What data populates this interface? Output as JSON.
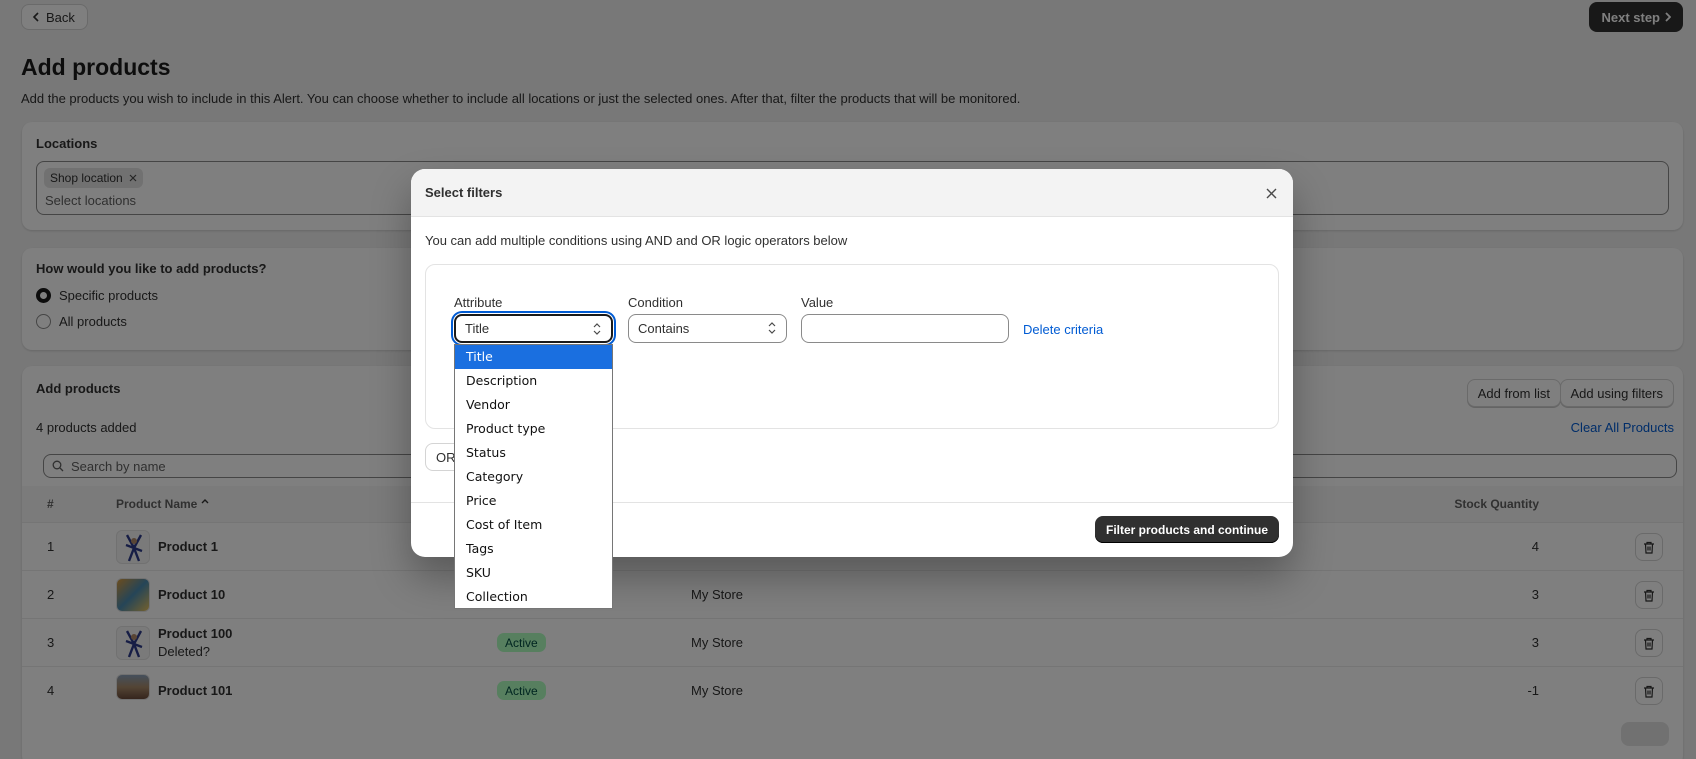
{
  "header": {
    "back_label": "Back",
    "next_label": "Next step",
    "title": "Add products",
    "subtitle": "Add the products you wish to include in this Alert. You can choose whether to include all locations or just the selected ones. After that, filter the products that will be monitored."
  },
  "locations": {
    "title": "Locations",
    "tag": "Shop location",
    "placeholder": "Select locations"
  },
  "how": {
    "title": "How would you like to add products?",
    "options": [
      "Specific products",
      "All products"
    ],
    "selected": "Specific products"
  },
  "products": {
    "title": "Add products",
    "add_from_list": "Add from list",
    "add_using_filters": "Add using filters",
    "count_text": "4 products added",
    "clear_all": "Clear All Products",
    "search_placeholder": "Search by name",
    "columns": {
      "num": "#",
      "name": "Product Name",
      "stock": "Stock Quantity"
    },
    "rows": [
      {
        "num": "1",
        "name": "Product 1",
        "note": "",
        "status": "",
        "store": "",
        "stock": "4"
      },
      {
        "num": "2",
        "name": "Product 10",
        "note": "",
        "status": "",
        "store": "My Store",
        "stock": "3"
      },
      {
        "num": "3",
        "name": "Product 100",
        "note": "Deleted?",
        "status": "Active",
        "store": "My Store",
        "stock": "3"
      },
      {
        "num": "4",
        "name": "Product 101",
        "note": "",
        "status": "Active",
        "store": "My Store",
        "stock": "-1"
      }
    ]
  },
  "modal": {
    "title": "Select filters",
    "intro": "You can add multiple conditions using AND and OR logic operators below",
    "attribute_label": "Attribute",
    "attribute_value": "Title",
    "condition_label": "Condition",
    "condition_value": "Contains",
    "value_label": "Value",
    "value_input": "",
    "delete_criteria": "Delete criteria",
    "or_label": "OR",
    "primary_button": "Filter products and continue"
  },
  "dropdown": {
    "options": [
      "Title",
      "Description",
      "Vendor",
      "Product type",
      "Status",
      "Category",
      "Price",
      "Cost of Item",
      "Tags",
      "SKU",
      "Collection"
    ],
    "selected": "Title"
  },
  "colors": {
    "accent": "#005bd3",
    "primary_dark": "#303030",
    "badge_bg": "#affebf",
    "badge_text": "#014b40",
    "dropdown_selected": "#1a6fe0"
  }
}
